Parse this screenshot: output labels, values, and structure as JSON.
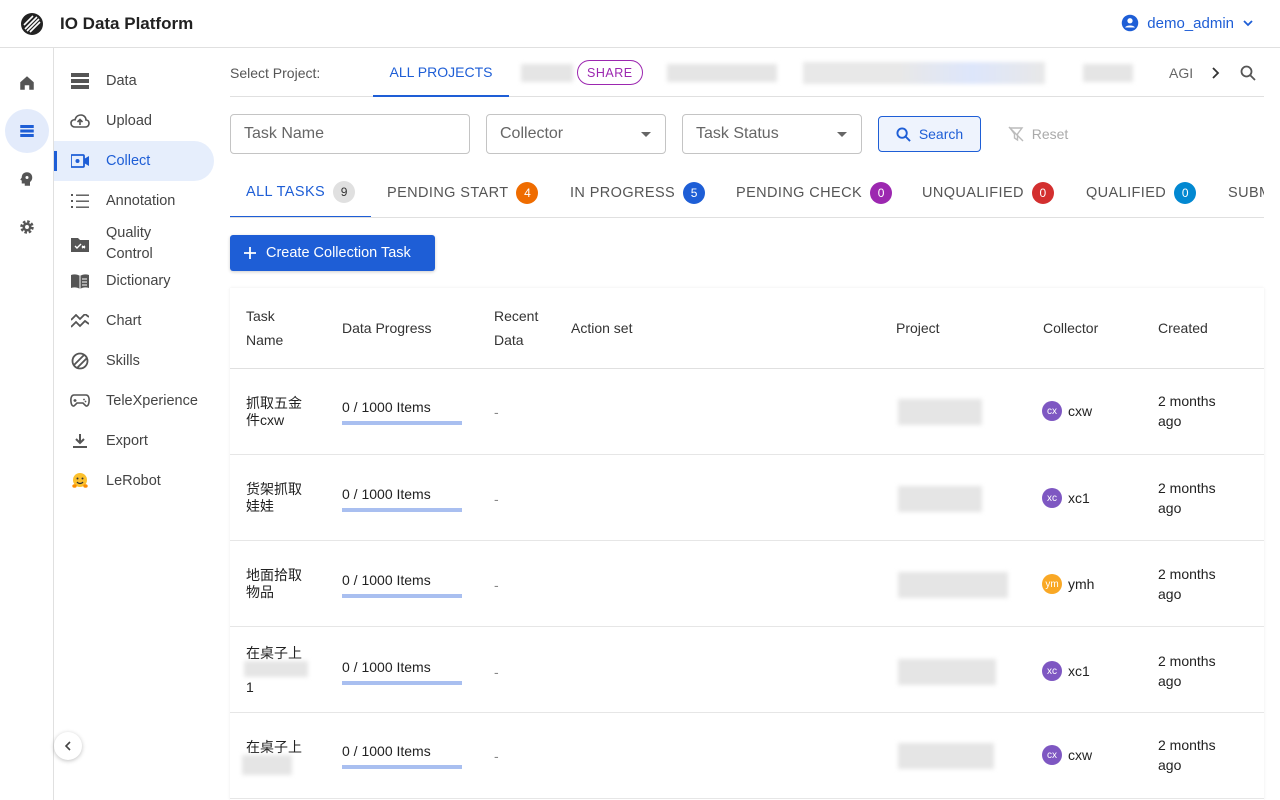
{
  "app": {
    "title": "IO Data Platform",
    "user": "demo_admin"
  },
  "rail": {
    "items": [
      "home-icon",
      "data-icon",
      "brain-icon",
      "gear-icon"
    ]
  },
  "sidebar": {
    "items": [
      {
        "label": "Data",
        "icon": "storage-icon"
      },
      {
        "label": "Upload",
        "icon": "cloud-upload-icon"
      },
      {
        "label": "Collect",
        "icon": "video-camera-icon"
      },
      {
        "label": "Annotation",
        "icon": "list-icon"
      },
      {
        "label": "Quality Control",
        "icon": "checklist-folder-icon"
      },
      {
        "label": "Dictionary",
        "icon": "book-icon"
      },
      {
        "label": "Chart",
        "icon": "chart-icon"
      },
      {
        "label": "Skills",
        "icon": "skills-icon"
      },
      {
        "label": "TeleXperience",
        "icon": "gamepad-icon"
      },
      {
        "label": "Export",
        "icon": "download-icon"
      },
      {
        "label": "LeRobot",
        "icon": "hugging-face-icon"
      }
    ]
  },
  "projects": {
    "label": "Select Project:",
    "all": "ALL PROJECTS",
    "share": "SHARE",
    "agi": "AGI"
  },
  "filters": {
    "task_name": "Task Name",
    "collector": "Collector",
    "task_status": "Task Status",
    "search": "Search",
    "reset": "Reset"
  },
  "status_tabs": [
    {
      "label": "ALL TASKS",
      "count": "9",
      "color": "#e0e0e0"
    },
    {
      "label": "PENDING START",
      "count": "4",
      "color": "#ef6c00"
    },
    {
      "label": "IN PROGRESS",
      "count": "5",
      "color": "#1e5ed6"
    },
    {
      "label": "PENDING CHECK",
      "count": "0",
      "color": "#9c27b0"
    },
    {
      "label": "UNQUALIFIED",
      "count": "0",
      "color": "#d32f2f"
    },
    {
      "label": "QUALIFIED",
      "count": "0",
      "color": "#0288d1"
    },
    {
      "label": "SUBM",
      "count": "",
      "color": ""
    }
  ],
  "create_button": "Create Collection Task",
  "table": {
    "headers": {
      "task_name": "Task Name",
      "data_progress": "Data Progress",
      "recent_data": "Recent Data",
      "action_set": "Action set",
      "project": "Project",
      "collector": "Collector",
      "created": "Created"
    },
    "rows": [
      {
        "name1": "抓取五金",
        "name2": "件cxw",
        "progress": "0 / 1000 Items",
        "recent": "-",
        "collector_initials": "cx",
        "collector": "cxw",
        "avatar_color": "#7e57c2",
        "created1": "2 months",
        "created2": "ago"
      },
      {
        "name1": "货架抓取",
        "name2": "娃娃",
        "progress": "0 / 1000 Items",
        "recent": "-",
        "collector_initials": "xc",
        "collector": "xc1",
        "avatar_color": "#7e57c2",
        "created1": "2 months",
        "created2": "ago"
      },
      {
        "name1": "地面拾取",
        "name2": "物品",
        "progress": "0 / 1000 Items",
        "recent": "-",
        "collector_initials": "ym",
        "collector": "ymh",
        "avatar_color": "#f9a825",
        "created1": "2 months",
        "created2": "ago"
      },
      {
        "name1": "在桌子上",
        "name2": "1",
        "progress": "0 / 1000 Items",
        "recent": "-",
        "collector_initials": "xc",
        "collector": "xc1",
        "avatar_color": "#7e57c2",
        "created1": "2 months",
        "created2": "ago"
      },
      {
        "name1": "在桌子上",
        "name2": "",
        "progress": "0 / 1000 Items",
        "recent": "-",
        "collector_initials": "cx",
        "collector": "cxw",
        "avatar_color": "#7e57c2",
        "created1": "2 months",
        "created2": "ago"
      }
    ]
  }
}
